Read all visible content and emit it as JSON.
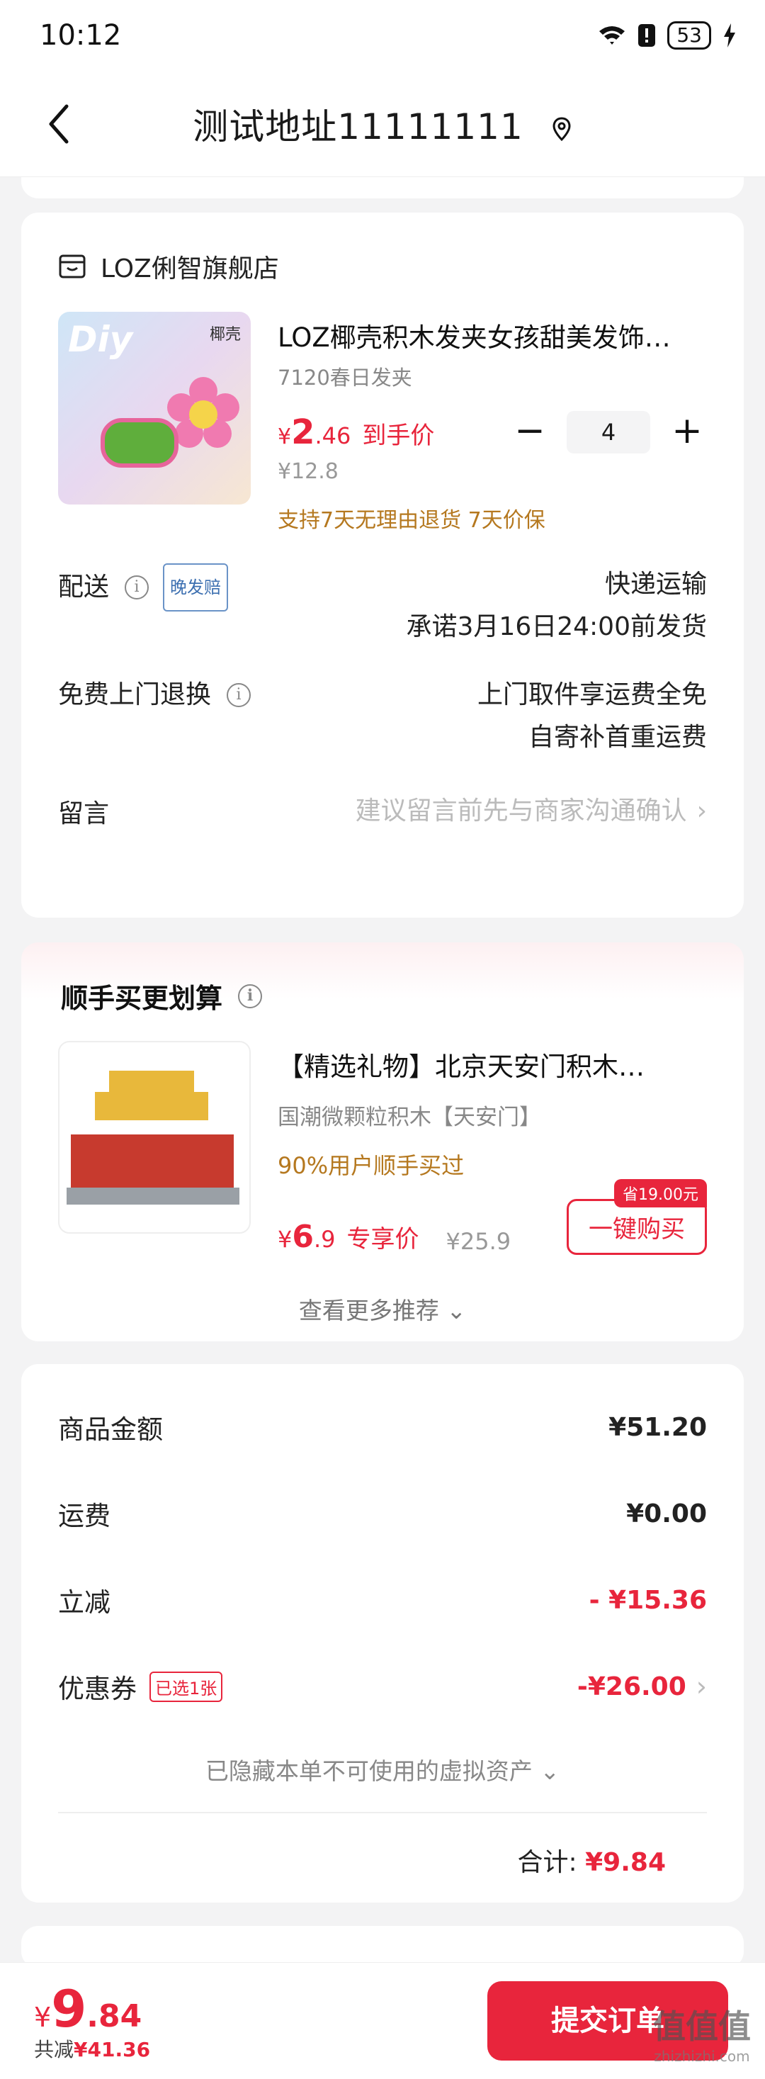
{
  "status_bar": {
    "time": "10:12",
    "battery": "53"
  },
  "header": {
    "title": "测试地址11111111"
  },
  "store": {
    "name": "LOZ俐智旗舰店",
    "product": {
      "thumb_brand": "椰壳",
      "thumb_text": "Diy",
      "name": "LOZ椰壳积木发夹女孩甜美发饰…",
      "spec": "7120春日发夹",
      "price_int": "2",
      "price_dec": ".46",
      "price_currency": "¥",
      "price_label": "到手价",
      "original_price": "¥12.8",
      "quantity": "4",
      "guarantee": "支持7天无理由退货 7天价保"
    },
    "delivery": {
      "label": "配送",
      "badge": "晚发赔",
      "method": "快递运输",
      "promise": "承诺3月16日24:00前发货"
    },
    "free_return": {
      "label": "免费上门退换",
      "line1": "上门取件享运费全免",
      "line2": "自寄补首重运费"
    },
    "message": {
      "label": "留言",
      "placeholder": "建议留言前先与商家沟通确认"
    }
  },
  "recommend": {
    "title": "顺手买更划算",
    "item": {
      "name": "【精选礼物】北京天安门积木…",
      "spec": "国潮微颗粒积木【天安门】",
      "bought": "90%用户顺手买过",
      "price_currency": "¥",
      "price_int": "6",
      "price_dec": ".9",
      "price_label": "专享价",
      "original_price": "¥25.9",
      "save_tag": "省19.00元",
      "buy_label": "一键购买"
    },
    "see_more": "查看更多推荐"
  },
  "summary": {
    "goods_label": "商品金额",
    "goods_value": "¥51.20",
    "shipping_label": "运费",
    "shipping_value": "¥0.00",
    "discount_label": "立减",
    "discount_value": "- ¥15.36",
    "coupon_label": "优惠券",
    "coupon_badge": "已选1张",
    "coupon_value": "-¥26.00",
    "hidden_note": "已隐藏本单不可使用的虚拟资产",
    "total_label": "合计:",
    "total_value": "¥9.84"
  },
  "bottom_bar": {
    "currency": "¥",
    "price_int": "9",
    "price_dec": ".84",
    "saved_label": "共减",
    "saved_value": "¥41.36",
    "submit_label": "提交订单"
  },
  "watermark": {
    "big": "值值值",
    "small": "zhizhizhi.com"
  },
  "colors": {
    "accent": "#e8253c",
    "guarantee": "#b5781f",
    "background": "#f3f3f4"
  }
}
